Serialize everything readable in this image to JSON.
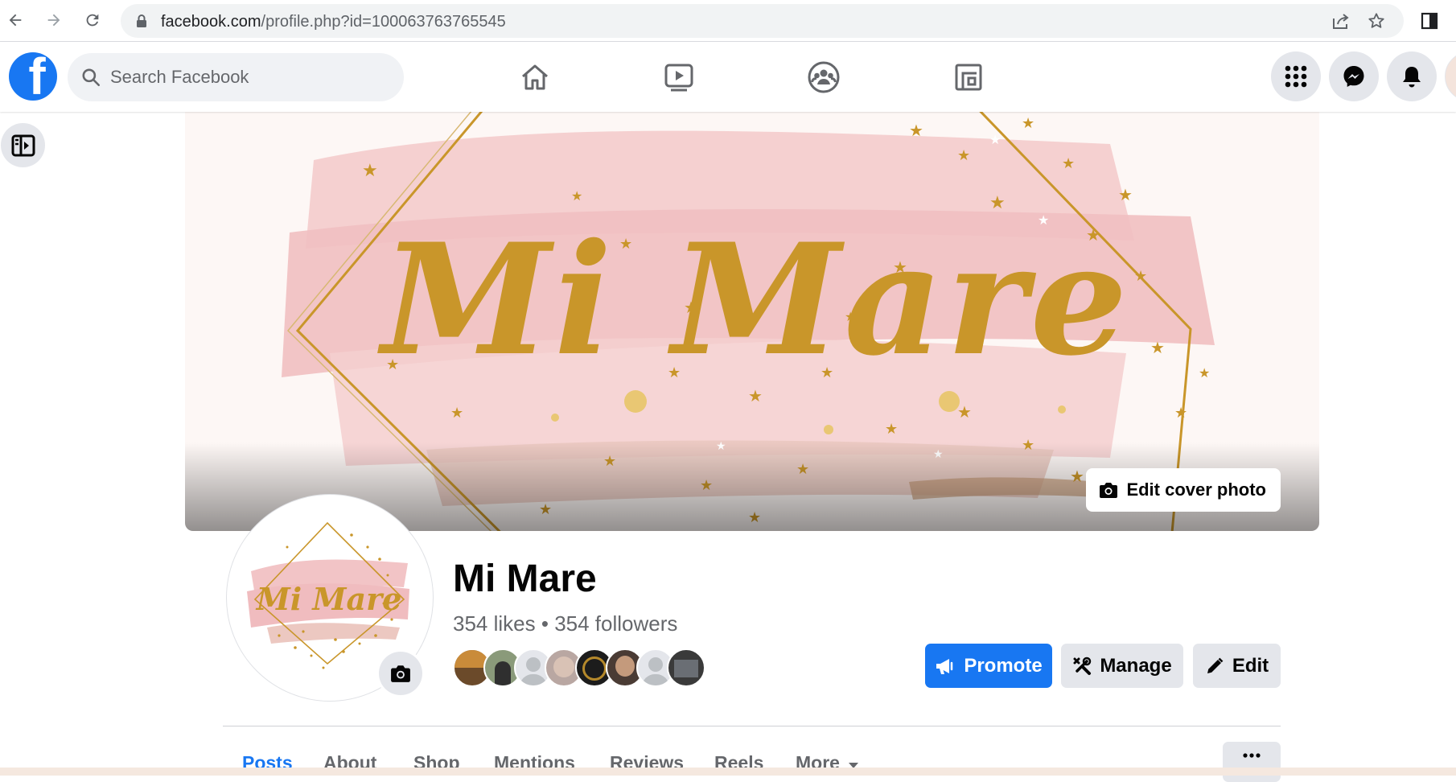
{
  "browser": {
    "url_host": "facebook.com",
    "url_path": "/profile.php?id=100063763765545"
  },
  "header": {
    "logo_letter": "f",
    "search_placeholder": "Search Facebook"
  },
  "cover": {
    "brand_text": "Mi Mare",
    "edit_cover_label": "Edit cover photo"
  },
  "profile": {
    "name": "Mi Mare",
    "likes": "354 likes",
    "separator": "•",
    "followers": "354 followers",
    "avatar_brand_text": "Mi Mare"
  },
  "actions": {
    "promote_label": "Promote",
    "manage_label": "Manage",
    "edit_label": "Edit"
  },
  "tabs": [
    {
      "label": "Posts",
      "active": true
    },
    {
      "label": "About"
    },
    {
      "label": "Shop"
    },
    {
      "label": "Mentions"
    },
    {
      "label": "Reviews"
    },
    {
      "label": "Reels"
    },
    {
      "label": "More"
    }
  ],
  "colors": {
    "brand_blue": "#1877f2",
    "gold": "#c9962a",
    "pink": "#f2c4c6"
  }
}
